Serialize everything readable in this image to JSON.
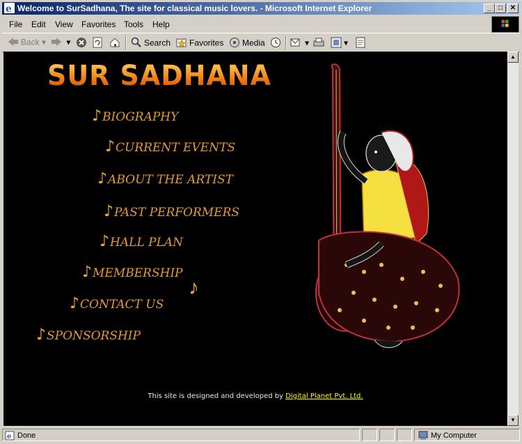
{
  "window": {
    "title": "Welcome to SurSadhana, The site for classical music lovers. - Microsoft Internet Explorer",
    "controls": {
      "minimize": "_",
      "maximize": "□",
      "close": "✕"
    }
  },
  "menu": [
    "File",
    "Edit",
    "View",
    "Favorites",
    "Tools",
    "Help"
  ],
  "toolbar": {
    "back": "Back",
    "search": "Search",
    "favorites": "Favorites",
    "media": "Media"
  },
  "page": {
    "logo": "SUR SADHANA",
    "nav": [
      {
        "label": "BIOGRAPHY"
      },
      {
        "label": "CURRENT EVENTS"
      },
      {
        "label": "ABOUT THE ARTIST"
      },
      {
        "label": "PAST PERFORMERS"
      },
      {
        "label": "HALL PLAN"
      },
      {
        "label": "MEMBERSHIP"
      },
      {
        "label": "CONTACT US"
      },
      {
        "label": "SPONSORSHIP"
      }
    ],
    "footer_text": "This site is designed and developed by",
    "footer_link": "Digital Planet Pvt. Ltd.",
    "note_symbol": "♪"
  },
  "status": {
    "left": "Done",
    "zone": "My Computer"
  }
}
